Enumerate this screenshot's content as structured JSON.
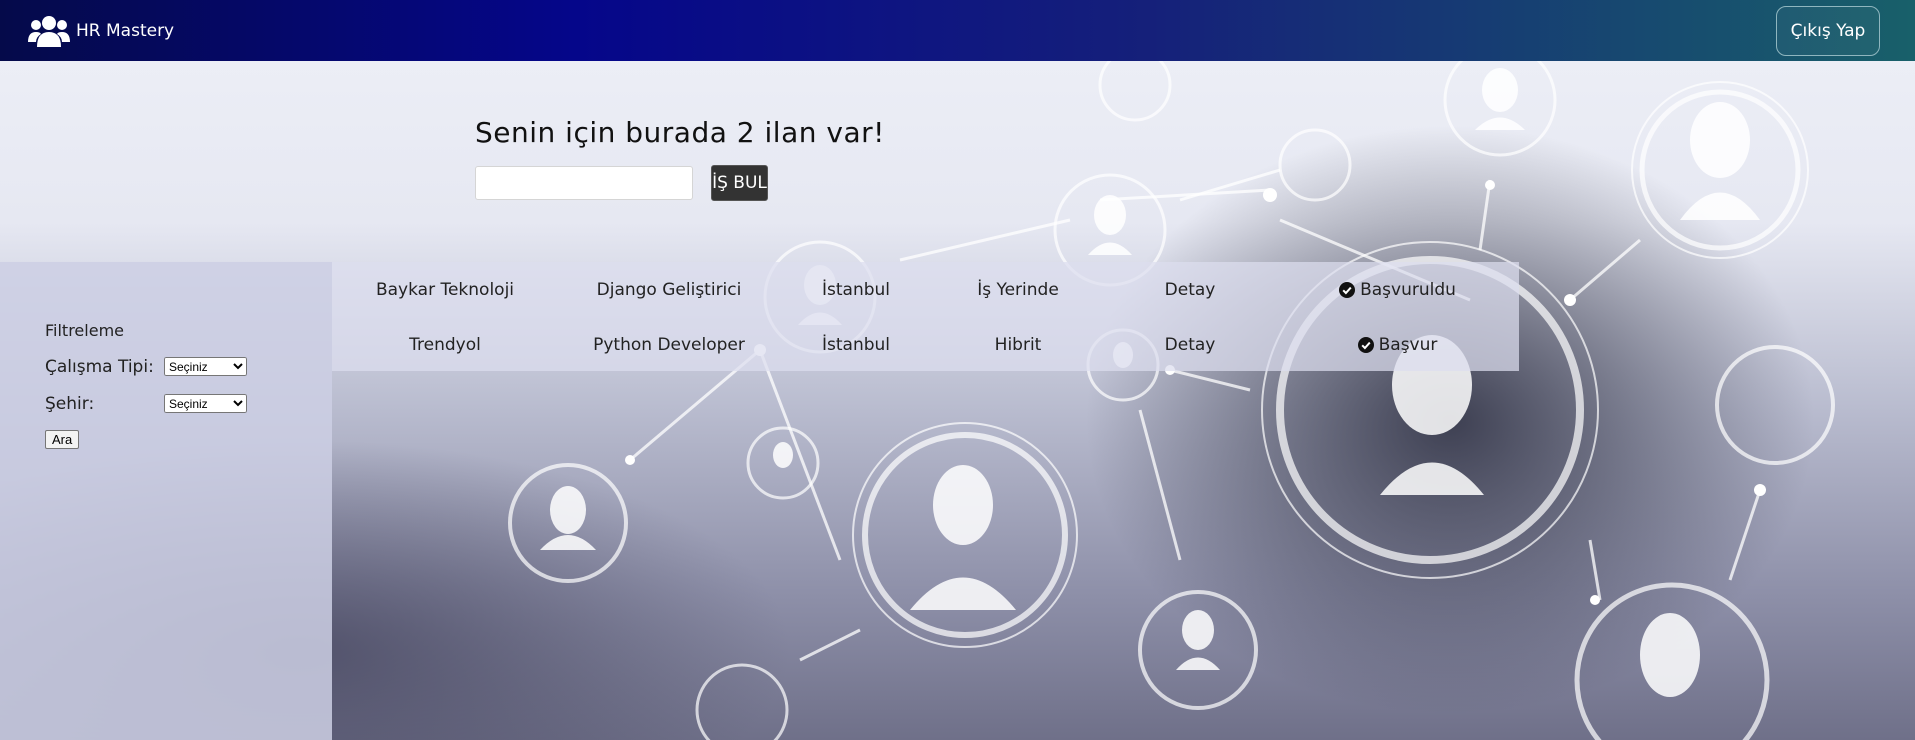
{
  "header": {
    "brand": "HR Mastery",
    "brand_icon": "users-icon",
    "logout_label": "Çıkış Yap"
  },
  "hero": {
    "title": "Senin için burada 2 ilan var!",
    "search_value": "",
    "search_button": "İŞ BUL"
  },
  "filter": {
    "title": "Filtreleme",
    "work_type_label": "Çalışma Tipi:",
    "work_type_selected": "Seçiniz",
    "city_label": "Şehir:",
    "city_selected": "Seçiniz",
    "submit_label": "Ara"
  },
  "jobs": [
    {
      "company": "Baykar Teknoloji",
      "position": "Django Geliştirici",
      "city": "İstanbul",
      "work_type": "İş Yerinde",
      "detail": "Detay",
      "action": "Başvuruldu",
      "action_icon": "check-circle-icon"
    },
    {
      "company": "Trendyol",
      "position": "Python Developer",
      "city": "İstanbul",
      "work_type": "Hibrit",
      "detail": "Detay",
      "action": "Başvur",
      "action_icon": "check-circle-icon"
    }
  ],
  "colors": {
    "header_start": "#05068a",
    "header_end": "#18606a",
    "search_button_bg": "#333333"
  }
}
